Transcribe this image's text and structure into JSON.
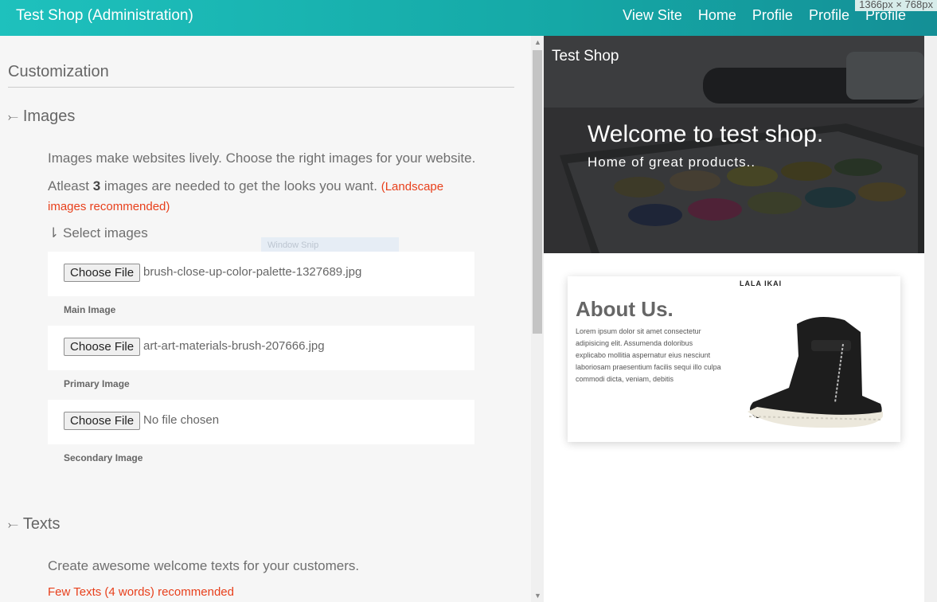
{
  "header": {
    "title": "Test Shop (Administration)",
    "nav": [
      "View Site",
      "Home",
      "Profile",
      "Profile",
      "Profile"
    ],
    "dimensions_badge": "1366px × 768px"
  },
  "customization": {
    "title": "Customization",
    "images": {
      "heading": "Images",
      "intro": "Images make websites lively. Choose the right images for your website.",
      "count_prefix": "Atleast",
      "count_value": "3",
      "count_suffix": "images are needed to get the looks you want.",
      "recommend_1": "(Landscape",
      "recommend_2": "images recommended)",
      "select_label": "Select images",
      "files": [
        {
          "button": "Choose File",
          "filename": "brush-close-up-color-palette-1327689.jpg",
          "label": "Main Image"
        },
        {
          "button": "Choose File",
          "filename": "art-art-materials-brush-207666.jpg",
          "label": "Primary Image"
        },
        {
          "button": "Choose File",
          "filename": "No file chosen",
          "label": "Secondary Image"
        }
      ]
    },
    "texts": {
      "heading": "Texts",
      "intro": "Create awesome welcome texts for your customers.",
      "recommend": "Few Texts (4 words) recommended"
    }
  },
  "overlay": {
    "snip_label": "Window Snip"
  },
  "preview": {
    "brand": "Test Shop",
    "hero_title": "Welcome to test shop.",
    "hero_subtitle": "Home of great products..",
    "about": {
      "logo": "LALA IKAI",
      "title": "About Us.",
      "body": "Lorem ipsum dolor sit amet consectetur adipisicing elit. Assumenda doloribus explicabo mollitia aspernatur eius nesciunt laboriosam praesentium facilis sequi illo culpa commodi dicta, veniam, debitis"
    }
  },
  "colors": {
    "accent": "#1ec1bd",
    "warning": "#e8401c"
  }
}
